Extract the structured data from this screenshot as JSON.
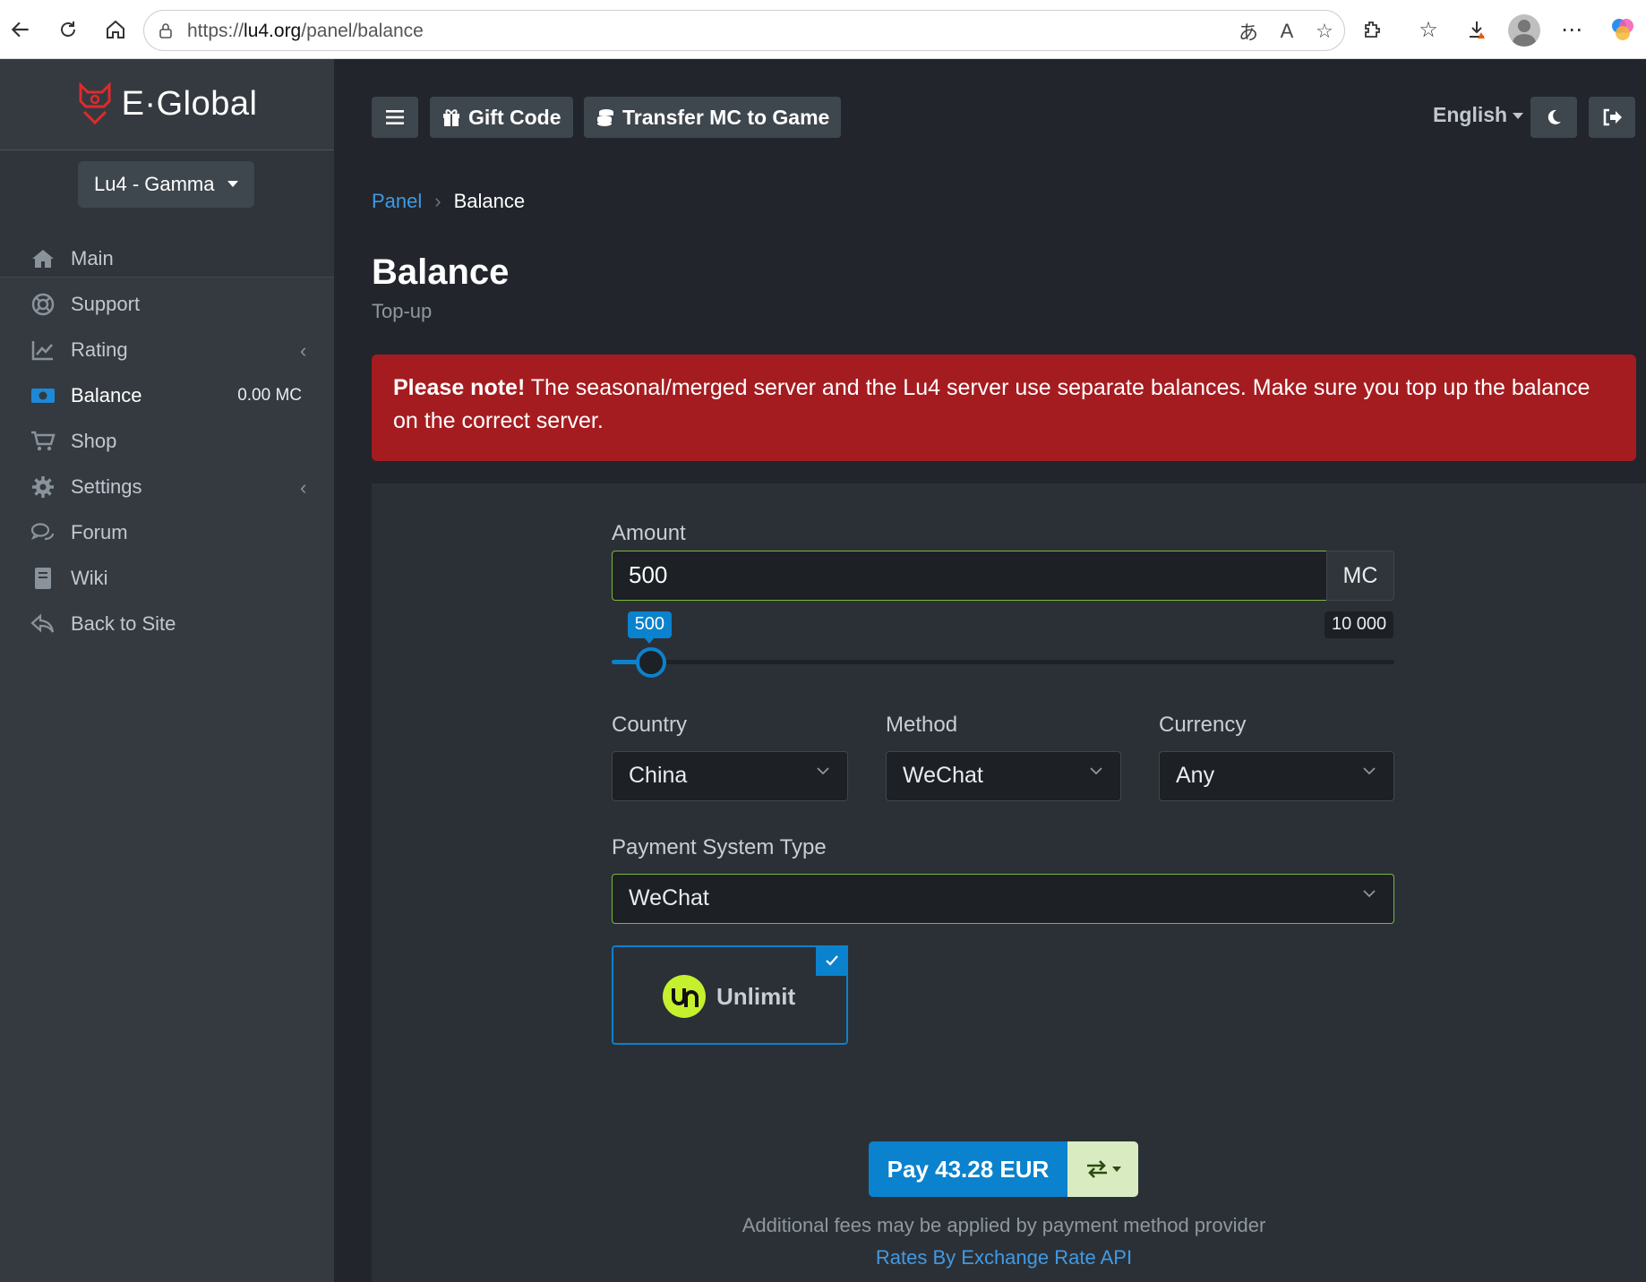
{
  "browser": {
    "url_prefix": "https://",
    "url_host": "lu4.org",
    "url_path": "/panel/balance"
  },
  "sidebar": {
    "brand": "E·Global",
    "server_select": "Lu4 - Gamma",
    "items": [
      {
        "label": "Main",
        "icon": "home-icon"
      },
      {
        "label": "Support",
        "icon": "lifebuoy-icon"
      },
      {
        "label": "Rating",
        "icon": "chart-line-icon",
        "has_submenu": true
      },
      {
        "label": "Balance",
        "icon": "money-bill-icon",
        "badge": "0.00 MC",
        "active": true
      },
      {
        "label": "Shop",
        "icon": "cart-icon"
      },
      {
        "label": "Settings",
        "icon": "gear-icon",
        "has_submenu": true
      },
      {
        "label": "Forum",
        "icon": "comments-icon"
      },
      {
        "label": "Wiki",
        "icon": "book-icon"
      },
      {
        "label": "Back to Site",
        "icon": "reply-icon"
      }
    ]
  },
  "topbar": {
    "gift_code": "Gift Code",
    "transfer": "Transfer MC to Game",
    "language": "English"
  },
  "breadcrumb": {
    "parent": "Panel",
    "current": "Balance"
  },
  "page": {
    "title": "Balance",
    "subtitle": "Top-up"
  },
  "alert": {
    "strong": "Please note!",
    "text": " The seasonal/merged server and the Lu4 server use separate balances. Make sure you top up the balance on the correct server."
  },
  "form": {
    "amount_label": "Amount",
    "amount_value": "500",
    "amount_unit": "MC",
    "slider_value_label": "500",
    "slider_max_label": "10 000",
    "slider_fraction": 0.05,
    "country_label": "Country",
    "country_value": "China",
    "method_label": "Method",
    "method_value": "WeChat",
    "currency_label": "Currency",
    "currency_value": "Any",
    "pst_label": "Payment System Type",
    "pst_value": "WeChat",
    "provider_name": "Unlimit",
    "provider_logo_text": "Un",
    "provider_selected": true
  },
  "pay": {
    "button": "Pay 43.28 EUR",
    "note": "Additional fees may be applied by payment method provider",
    "rates_link": "Rates By Exchange Rate API"
  },
  "colors": {
    "accent": "#0b82cd",
    "alert": "#a51c20",
    "valid": "#7ab83a",
    "sidebar": "#343a40",
    "content": "#22252b"
  }
}
